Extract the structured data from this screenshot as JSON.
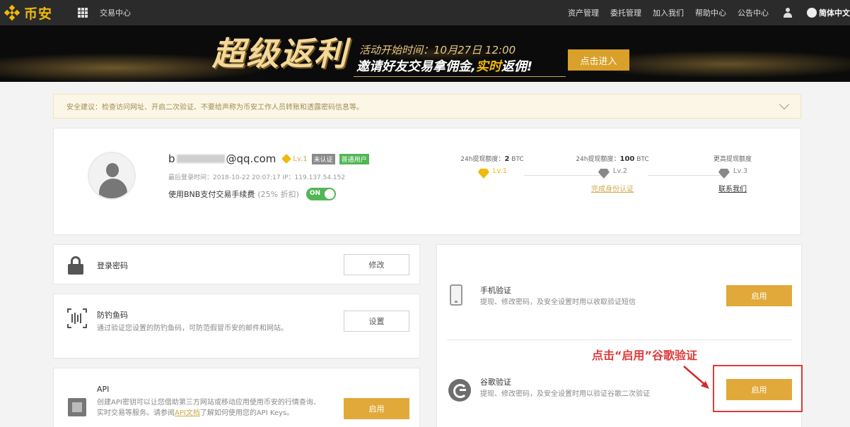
{
  "nav": {
    "logo_text": "币安",
    "trade_center": "交易中心",
    "links": [
      "资产管理",
      "委托管理",
      "加入我们",
      "帮助中心",
      "公告中心"
    ],
    "language": "简体中文"
  },
  "banner": {
    "title": "超级返利",
    "time": "活动开始时间：10月27日 12:00",
    "subtitle_part1": "邀请好友交易拿佣金,",
    "subtitle_highlight": "实时",
    "subtitle_part2": "返佣!",
    "button": "点击进入"
  },
  "tip": {
    "text": "安全建议：检查访问网址、开启二次验证、不要给声称为币安工作人员转账和透露密码信息等。"
  },
  "profile": {
    "email_prefix": "b",
    "email_suffix": "@qq.com",
    "level": "Lv.1",
    "badge_unverified": "未认证",
    "badge_user": "普通用户",
    "last_login": "最后登录时间：2018-10-22 20:07:17    IP：119.137.54.152",
    "bnb_label": "使用BNB支付交易手续费",
    "bnb_discount": "(25% 折扣)",
    "toggle": "ON"
  },
  "limits": [
    {
      "caption": "24h提现额度：",
      "amount": "2",
      "unit": "BTC",
      "level": "Lv.1",
      "action": ""
    },
    {
      "caption": "24h提现额度：",
      "amount": "100",
      "unit": "BTC",
      "level": "Lv.2",
      "action": "完成身份认证"
    },
    {
      "caption": "更高提现额度",
      "amount": "",
      "unit": "",
      "level": "Lv.3",
      "action": "联系我们"
    }
  ],
  "login_password": {
    "title": "登录密码",
    "button": "修改"
  },
  "anti_phishing": {
    "title": "防钓鱼码",
    "desc": "通过验证您设置的防钓鱼码，可防范假冒币安的邮件和网站。",
    "button": "设置"
  },
  "api": {
    "title": "API",
    "desc_1": "创建API密钥可以让您借助第三方网站或移动应用使用币安的行情查询、实时交易等服务。请参阅",
    "link": "API文档",
    "desc_2": "了解如何使用您的API Keys。",
    "button": "启用"
  },
  "phone_verify": {
    "title": "手机验证",
    "desc": "提现、修改密码，及安全设置时用以收取验证短信",
    "button": "启用"
  },
  "google_verify": {
    "title": "谷歌验证",
    "desc": "提现、修改密码，及安全设置时用以验证谷歌二次验证",
    "button": "启用"
  },
  "annotation": "点击“启用”谷歌验证",
  "colors": {
    "brand": "#f0b90b",
    "button_gold": "#e0a93a",
    "annotation_red": "#e03a3a",
    "toggle_green": "#52b656"
  }
}
